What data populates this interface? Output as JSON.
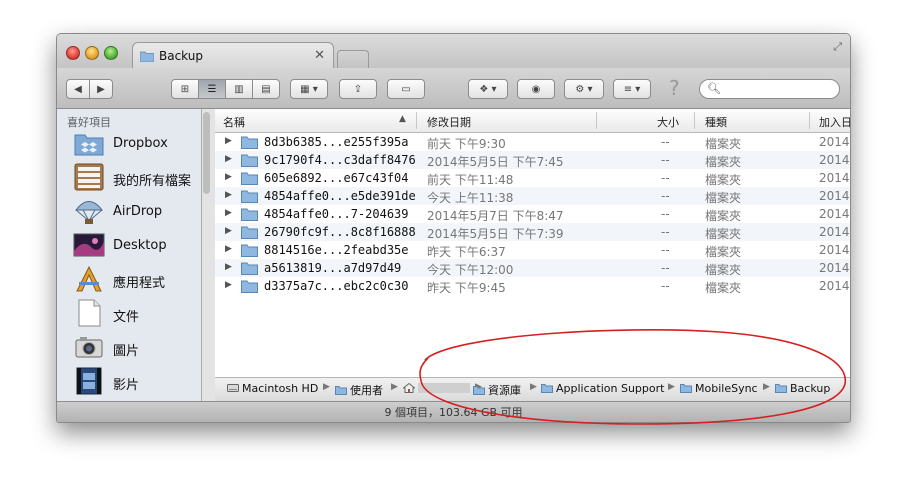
{
  "window": {
    "tab_title": "Backup",
    "tab_close_glyph": "✕"
  },
  "toolbar": {
    "back_glyph": "◀",
    "forward_glyph": "▶",
    "view_icon_glyph": "⊞",
    "view_list_glyph": "☰",
    "view_column_glyph": "▥",
    "view_coverflow_glyph": "▤",
    "arrange_glyph": "▦ ▾",
    "share_glyph": "⇪",
    "label_glyph": "▭",
    "dropbox_glyph": "❖ ▾",
    "quicklook_glyph": "◉",
    "action_glyph": "⚙ ▾",
    "sort_glyph": "≡ ▾",
    "help_glyph": "?",
    "search_placeholder": ""
  },
  "sidebar": {
    "header": "喜好項目",
    "items": [
      {
        "label": "Dropbox",
        "icon": "dropbox-icon"
      },
      {
        "label": "我的所有檔案",
        "icon": "all-files-icon"
      },
      {
        "label": "AirDrop",
        "icon": "airdrop-icon"
      },
      {
        "label": "Desktop",
        "icon": "desktop-icon"
      },
      {
        "label": "應用程式",
        "icon": "applications-icon"
      },
      {
        "label": "文件",
        "icon": "documents-icon"
      },
      {
        "label": "圖片",
        "icon": "pictures-icon"
      },
      {
        "label": "影片",
        "icon": "movies-icon"
      }
    ]
  },
  "columns": {
    "name": "名稱",
    "date_modified": "修改日期",
    "size": "大小",
    "kind": "種類",
    "date_added": "加入日"
  },
  "files": [
    {
      "name": "8d3b6385...e255f395a",
      "modified": "前天 下午9:30",
      "size": "--",
      "kind": "檔案夾",
      "added": "2014"
    },
    {
      "name": "9c1790f4...c3daff8476",
      "modified": "2014年5月5日 下午7:45",
      "size": "--",
      "kind": "檔案夾",
      "added": "2014"
    },
    {
      "name": "605e6892...e67c43f04",
      "modified": "前天 下午11:48",
      "size": "--",
      "kind": "檔案夾",
      "added": "2014"
    },
    {
      "name": "4854affe0...e5de391de",
      "modified": "今天 上午11:38",
      "size": "--",
      "kind": "檔案夾",
      "added": "2014"
    },
    {
      "name": "4854affe0...7-204639",
      "modified": "2014年5月7日 下午8:47",
      "size": "--",
      "kind": "檔案夾",
      "added": "2014"
    },
    {
      "name": "26790fc9f...8c8f16888",
      "modified": "2014年5月5日 下午7:39",
      "size": "--",
      "kind": "檔案夾",
      "added": "2014"
    },
    {
      "name": "8814516e...2feabd35e",
      "modified": "昨天 下午6:37",
      "size": "--",
      "kind": "檔案夾",
      "added": "2014"
    },
    {
      "name": "a5613819...a7d97d49",
      "modified": "今天 下午12:00",
      "size": "--",
      "kind": "檔案夾",
      "added": "2014"
    },
    {
      "name": "d3375a7c...ebc2c0c30",
      "modified": "昨天 下午9:45",
      "size": "--",
      "kind": "檔案夾",
      "added": "2014"
    }
  ],
  "path_bar": {
    "items": [
      "Macintosh HD",
      "使用者",
      "",
      "資源庫",
      "Application Support",
      "MobileSync",
      "Backup"
    ],
    "separator": "▶"
  },
  "status": {
    "text": "9 個項目，103.64 GB 可用"
  },
  "colors": {
    "annotation": "#d42020",
    "folder": "#8fb8e0",
    "sidebar_bg": "#e4e9ef"
  }
}
